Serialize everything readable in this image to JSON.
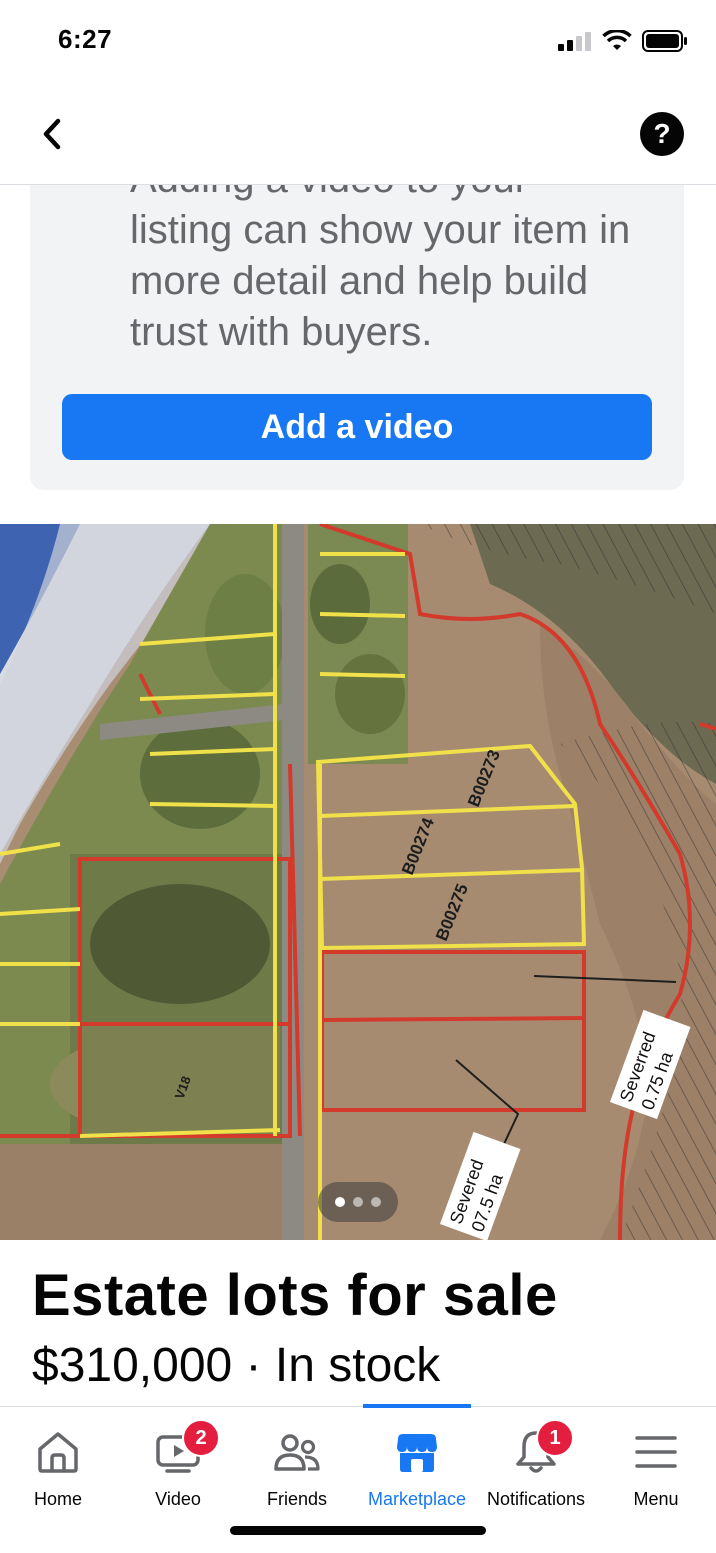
{
  "status_bar": {
    "time": "6:27"
  },
  "header": {
    "back_icon": "chevron-left-icon",
    "help_label": "?"
  },
  "video_prompt": {
    "text_partial": "Adding a video to your",
    "text": "listing can show your item in more detail and help build trust with buyers.",
    "button_label": "Add a video"
  },
  "photo": {
    "annotations": {
      "lot1": "B00273",
      "lot2": "B00274",
      "lot3": "B00275",
      "severed1_line1": "Severed",
      "severed1_line2": "07.5 ha",
      "severed2_line1": "Severred",
      "severed2_line2": "0.75 ha",
      "road_label": "V18"
    },
    "page_count": 3,
    "current_page": 1
  },
  "listing": {
    "title": "Estate lots for sale",
    "price": "$310,000",
    "separator": " · ",
    "availability": "In stock"
  },
  "nav": {
    "items": [
      {
        "label": "Home",
        "icon": "home-icon"
      },
      {
        "label": "Video",
        "icon": "video-icon",
        "badge": "2"
      },
      {
        "label": "Friends",
        "icon": "friends-icon"
      },
      {
        "label": "Marketplace",
        "icon": "marketplace-icon",
        "active": true
      },
      {
        "label": "Notifications",
        "icon": "bell-icon",
        "badge": "1"
      },
      {
        "label": "Menu",
        "icon": "menu-icon"
      }
    ]
  },
  "colors": {
    "accent": "#1877f2",
    "badge": "#e41e3f",
    "text_secondary": "#65676b"
  }
}
